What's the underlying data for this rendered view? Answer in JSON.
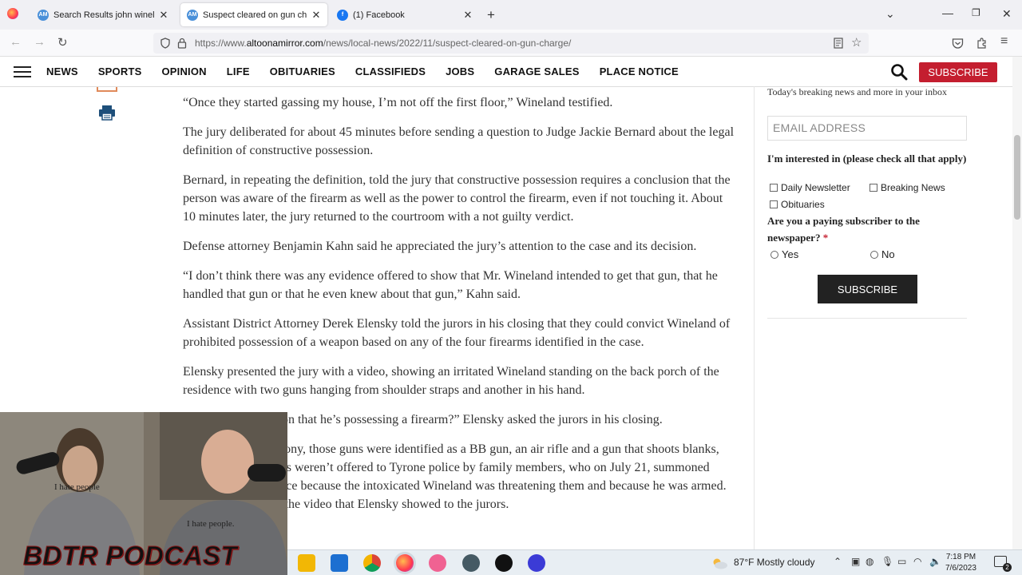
{
  "tabs": [
    {
      "title": "Search Results john wineland | Al",
      "active": false
    },
    {
      "title": "Suspect cleared on gun charge",
      "active": true
    },
    {
      "title": "(1) Facebook",
      "active": false
    }
  ],
  "address_bar": {
    "prefix": "https://www.",
    "domain": "altoonamirror.com",
    "path": "/news/local-news/2022/11/suspect-cleared-on-gun-charge/"
  },
  "site_nav": {
    "items": [
      "NEWS",
      "SPORTS",
      "OPINION",
      "LIFE",
      "OBITUARIES",
      "CLASSIFIEDS",
      "JOBS",
      "GARAGE SALES",
      "PLACE NOTICE"
    ],
    "subscribe_label": "SUBSCRIBE"
  },
  "article": {
    "paragraphs": [
      "“Once they started gassing my house, I’m not off the first floor,” Wineland testified.",
      "The jury deliberated for about 45 minutes before sending a question to Judge Jackie Bernard about the legal definition of constructive possession.",
      "Bernard, in repeating the definition, told the jury that constructive possession requires a conclusion that the person was aware of the firearm as well as the power to control the firearm, even if not touching it. About 10 minutes later, the jury returned to the courtroom with a not guilty verdict.",
      "Defense attorney Benjamin Kahn said he appreciated the jury’s attention to the case and its decision.",
      "“I don’t think there was any evidence offered to show that Mr. Wineland intended to get that gun, that he handled that gun or that he even knew about that gun,” Kahn said.",
      "Assistant District Attorney Derek Elensky told the jurors in his closing that they could convict Wineland of prohibited possession of a weapon based on any of the four firearms identified in the case.",
      "Elensky presented the jury with a video, showing an irritated Wineland standing on the back porch of the residence with two guns hanging from shoulder straps and another in his hand.",
      "“Is there any question that he’s possessing a firearm?” Elensky asked the jurors in his closing.",
      "According to testimony, those guns were identified as a BB gun, an air rifle and a gun that shoots blanks, but those distinctions weren’t offered to Tyrone police by family members, who on July 21, summoned police to the residence because the intoxicated Wineland was threatening them and because he was armed. They also provided the video that Elensky showed to the jurors."
    ]
  },
  "newsletter": {
    "intro": "Today's breaking news and more in your inbox",
    "email_placeholder": "EMAIL ADDRESS",
    "interest_question": "I'm interested in (please check all that apply)",
    "options": [
      "Daily Newsletter",
      "Breaking News",
      "Obituaries"
    ],
    "subscriber_question": "Are you a paying subscriber to the newspaper?",
    "required_mark": "*",
    "radio_options": [
      "Yes",
      "No"
    ],
    "submit_label": "SUBSCRIBE"
  },
  "webcam": {
    "overlay_text": "BDTR PODCAST LIVE",
    "shirt_text_left": "I hate people",
    "shirt_text_right": "I hate people."
  },
  "taskbar": {
    "weather": "87°F  Mostly cloudy",
    "time": "7:18 PM",
    "date": "7/6/2023",
    "notifications": "2"
  }
}
